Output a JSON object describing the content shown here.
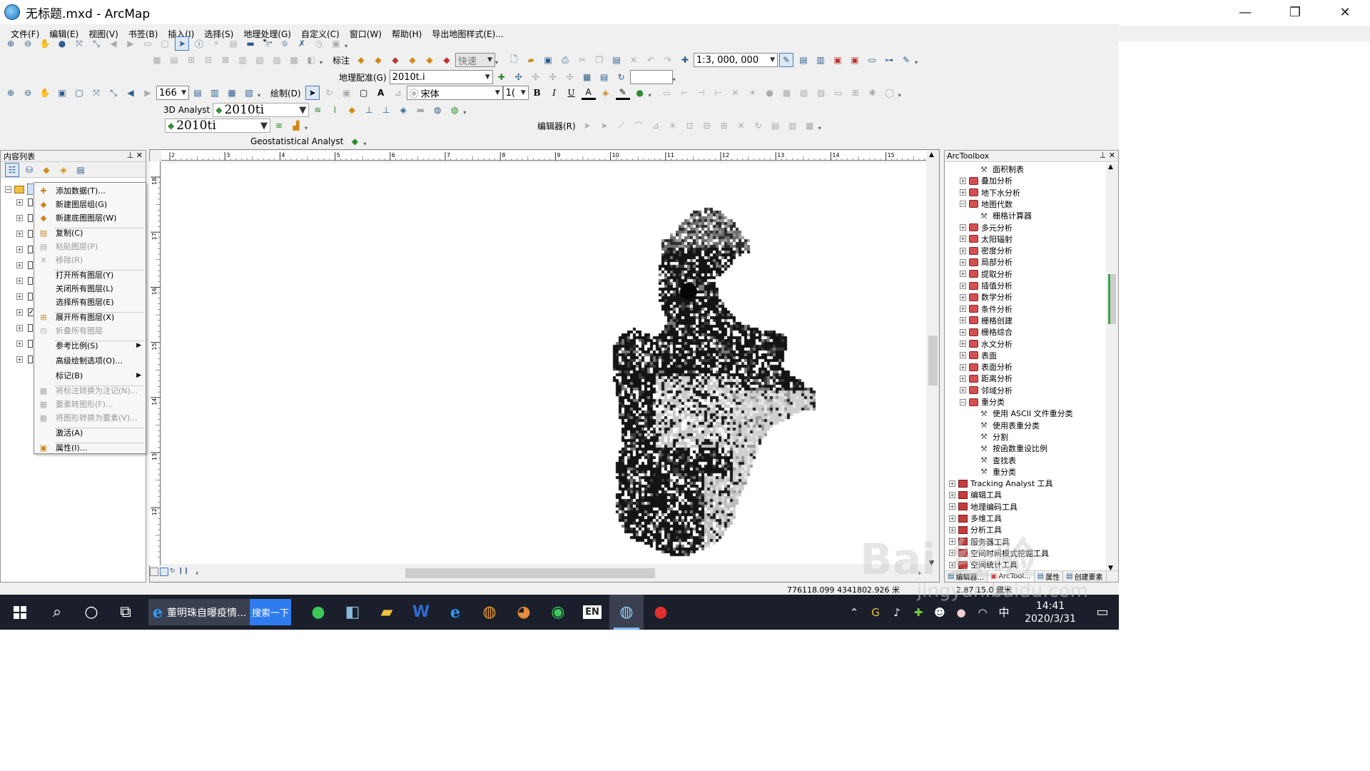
{
  "window": {
    "title": "无标题.mxd - ArcMap",
    "minimize": "—",
    "maximize": "❐",
    "close": "✕"
  },
  "menu": [
    "文件(F)",
    "编辑(E)",
    "视图(V)",
    "书签(B)",
    "插入(I)",
    "选择(S)",
    "地理处理(G)",
    "自定义(C)",
    "窗口(W)",
    "帮助(H)",
    "导出地图样式(E)..."
  ],
  "toolbars": {
    "label_toolbar": "标注",
    "label_quality": "快速",
    "scale": "1:3, 000, 000",
    "georef_label": "地理配准(G)",
    "georef_layer": "2010t.i",
    "zoom_value": "166",
    "draw_label": "绘制(D)",
    "font_name": "宋体",
    "font_size": "1(",
    "bold": "B",
    "italic": "I",
    "underline": "U",
    "font_color_letter": "A",
    "analyst3d_label": "3D Analyst",
    "analyst3d_layer": "2010ti",
    "editor_label": "编辑器(R)",
    "spatial_layer": "2010ti",
    "geostat_label": "Geostatistical Analyst"
  },
  "toc": {
    "title": "内容列表",
    "rows": [
      {
        "expander": "+",
        "checked": false
      },
      {
        "expander": "+",
        "checked": false
      },
      {
        "expander": "+",
        "checked": false
      },
      {
        "expander": "+",
        "checked": false
      },
      {
        "expander": "+",
        "checked": false
      },
      {
        "expander": "+",
        "checked": false
      },
      {
        "expander": "+",
        "checked": false
      },
      {
        "expander": "+",
        "checked": true
      },
      {
        "expander": "+",
        "checked": false
      },
      {
        "expander": "+",
        "checked": false
      },
      {
        "expander": "+",
        "checked": false
      }
    ]
  },
  "context_menu": {
    "items": [
      {
        "label": "添加数据(T)...",
        "icon": "add-data-icon",
        "glyph": "✚",
        "disabled": false
      },
      {
        "label": "新建图层组(G)",
        "icon": "layer-group-icon",
        "glyph": "◆",
        "disabled": false
      },
      {
        "label": "新建底图图层(W)",
        "icon": "basemap-layer-icon",
        "glyph": "◆",
        "disabled": false
      },
      {
        "label": "复制(C)",
        "icon": "copy-icon",
        "glyph": "▤",
        "disabled": false
      },
      {
        "label": "粘贴图层(P)",
        "icon": "paste-icon",
        "glyph": "▤",
        "disabled": true
      },
      {
        "label": "移除(R)",
        "icon": "remove-icon",
        "glyph": "✕",
        "disabled": true
      },
      {
        "label": "打开所有图层(Y)",
        "icon": "",
        "glyph": "",
        "disabled": false
      },
      {
        "label": "关闭所有图层(L)",
        "icon": "",
        "glyph": "",
        "disabled": false
      },
      {
        "label": "选择所有图层(E)",
        "icon": "",
        "glyph": "",
        "disabled": false
      },
      {
        "label": "展开所有图层(X)",
        "icon": "expand-icon",
        "glyph": "⊞",
        "disabled": false
      },
      {
        "label": "折叠所有图层",
        "icon": "collapse-icon",
        "glyph": "⊟",
        "disabled": true
      },
      {
        "label": "参考比例(S)",
        "icon": "",
        "glyph": "",
        "disabled": false,
        "submenu": true
      },
      {
        "label": "高级绘制选项(O)...",
        "icon": "",
        "glyph": "",
        "disabled": false
      },
      {
        "label": "标记(B)",
        "icon": "",
        "glyph": "",
        "disabled": false,
        "submenu": true
      },
      {
        "label": "将标注转换为注记(N)...",
        "icon": "convert-labels-icon",
        "glyph": "▦",
        "disabled": true
      },
      {
        "label": "要素转图形(F)...",
        "icon": "features-to-graphics-icon",
        "glyph": "▦",
        "disabled": true
      },
      {
        "label": "将图形转换为要素(V)...",
        "icon": "graphics-to-features-icon",
        "glyph": "▦",
        "disabled": true
      },
      {
        "label": "激活(A)",
        "icon": "",
        "glyph": "",
        "disabled": false
      },
      {
        "label": "属性(I)...",
        "icon": "properties-icon",
        "glyph": "▣",
        "disabled": false
      }
    ]
  },
  "ruler": {
    "top_ticks": [
      "2",
      "3",
      "4",
      "5",
      "6",
      "7",
      "8",
      "9",
      "10",
      "11",
      "12",
      "13",
      "14",
      "15"
    ],
    "left_ticks": [
      "18",
      "17",
      "16",
      "15",
      "14",
      "13",
      "12"
    ]
  },
  "toolbox": {
    "title": "ArcToolbox",
    "rows": [
      {
        "level": 2,
        "type": "tool",
        "label": "面积制表"
      },
      {
        "level": 1,
        "type": "toolset",
        "label": "叠加分析",
        "exp": "+"
      },
      {
        "level": 1,
        "type": "toolset",
        "label": "地下水分析",
        "exp": "+"
      },
      {
        "level": 1,
        "type": "toolset",
        "label": "地图代数",
        "exp": "−"
      },
      {
        "level": 2,
        "type": "tool",
        "label": "栅格计算器"
      },
      {
        "level": 1,
        "type": "toolset",
        "label": "多元分析",
        "exp": "+"
      },
      {
        "level": 1,
        "type": "toolset",
        "label": "太阳辐射",
        "exp": "+"
      },
      {
        "level": 1,
        "type": "toolset",
        "label": "密度分析",
        "exp": "+"
      },
      {
        "level": 1,
        "type": "toolset",
        "label": "局部分析",
        "exp": "+"
      },
      {
        "level": 1,
        "type": "toolset",
        "label": "提取分析",
        "exp": "+"
      },
      {
        "level": 1,
        "type": "toolset",
        "label": "插值分析",
        "exp": "+"
      },
      {
        "level": 1,
        "type": "toolset",
        "label": "数学分析",
        "exp": "+"
      },
      {
        "level": 1,
        "type": "toolset",
        "label": "条件分析",
        "exp": "+"
      },
      {
        "level": 1,
        "type": "toolset",
        "label": "栅格创建",
        "exp": "+"
      },
      {
        "level": 1,
        "type": "toolset",
        "label": "栅格综合",
        "exp": "+"
      },
      {
        "level": 1,
        "type": "toolset",
        "label": "水文分析",
        "exp": "+"
      },
      {
        "level": 1,
        "type": "toolset",
        "label": "表面",
        "exp": "+"
      },
      {
        "level": 1,
        "type": "toolset",
        "label": "表面分析",
        "exp": "+"
      },
      {
        "level": 1,
        "type": "toolset",
        "label": "距离分析",
        "exp": "+"
      },
      {
        "level": 1,
        "type": "toolset",
        "label": "邻域分析",
        "exp": "+"
      },
      {
        "level": 1,
        "type": "toolset",
        "label": "重分类",
        "exp": "−"
      },
      {
        "level": 2,
        "type": "tool",
        "label": "使用 ASCII 文件重分类"
      },
      {
        "level": 2,
        "type": "tool",
        "label": "使用表重分类"
      },
      {
        "level": 2,
        "type": "tool",
        "label": "分割"
      },
      {
        "level": 2,
        "type": "tool",
        "label": "按函数重设比例"
      },
      {
        "level": 2,
        "type": "tool",
        "label": "查找表"
      },
      {
        "level": 2,
        "type": "tool",
        "label": "重分类"
      },
      {
        "level": 0,
        "type": "toolbox",
        "label": "Tracking Analyst 工具",
        "exp": "+"
      },
      {
        "level": 0,
        "type": "toolbox",
        "label": "编辑工具",
        "exp": "+"
      },
      {
        "level": 0,
        "type": "toolbox",
        "label": "地理编码工具",
        "exp": "+"
      },
      {
        "level": 0,
        "type": "toolbox",
        "label": "多维工具",
        "exp": "+"
      },
      {
        "level": 0,
        "type": "toolbox",
        "label": "分析工具",
        "exp": "+"
      },
      {
        "level": 0,
        "type": "toolbox",
        "label": "服务器工具",
        "exp": "+"
      },
      {
        "level": 0,
        "type": "toolbox",
        "label": "空间时间模式挖掘工具",
        "exp": "+"
      },
      {
        "level": 0,
        "type": "toolbox",
        "label": "空间统计工具",
        "exp": "+"
      }
    ],
    "tabs": [
      "编辑器...",
      "ArcTool...",
      "属性",
      "创建要素"
    ]
  },
  "status": {
    "coords": "776118.099  4341802.926 米",
    "units": "2.87  15.0 厘米"
  },
  "taskbar": {
    "browser_title": "董明珠自曝疫情...",
    "browser_search": "搜索一下",
    "ime": "中",
    "time": "14:41",
    "date": "2020/3/31"
  },
  "watermark": {
    "brand": "Bai 经验",
    "site": "jingyan.baidu.com"
  }
}
